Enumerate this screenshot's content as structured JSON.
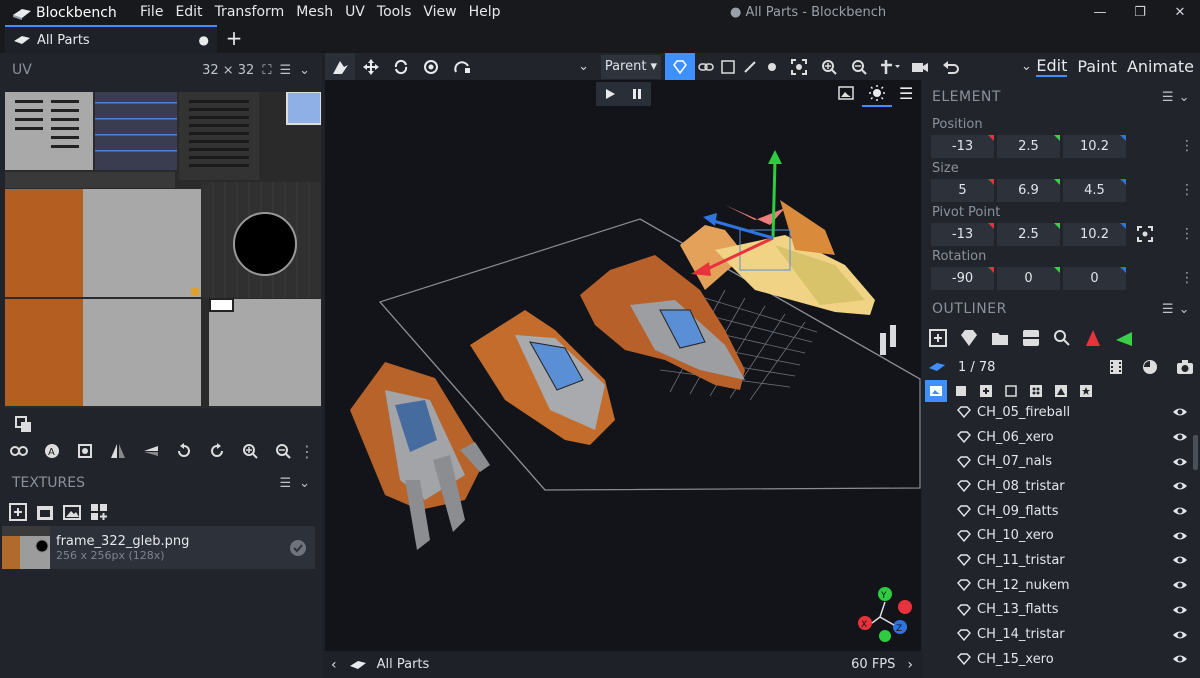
{
  "app": {
    "name": "Blockbench",
    "window_title": "● All Parts - Blockbench"
  },
  "menu": [
    "File",
    "Edit",
    "Transform",
    "Mesh",
    "UV",
    "Tools",
    "View",
    "Help"
  ],
  "window_controls": {
    "min": "—",
    "max": "❐",
    "close": "✕"
  },
  "tab": {
    "label": "All Parts",
    "modified": "●",
    "new": "+"
  },
  "uv_panel": {
    "title": "UV",
    "size": "32 ⨯ 32"
  },
  "textures_panel": {
    "title": "TEXTURES",
    "item": {
      "name": "frame_322_gleb.png",
      "resolution": "256 x 256px (128x)"
    }
  },
  "viewport": {
    "parent_select": "Parent ▾",
    "fps": "60 FPS",
    "footer_label": "All Parts"
  },
  "modes": [
    "Edit",
    "Paint",
    "Animate"
  ],
  "element_panel": {
    "title": "ELEMENT",
    "position": {
      "label": "Position",
      "values": [
        "-13",
        "2.5",
        "10.2"
      ]
    },
    "size": {
      "label": "Size",
      "values": [
        "5",
        "6.9",
        "4.5"
      ]
    },
    "pivot": {
      "label": "Pivot Point",
      "values": [
        "-13",
        "2.5",
        "10.2"
      ]
    },
    "rotation": {
      "label": "Rotation",
      "values": [
        "-90",
        "0",
        "0"
      ]
    }
  },
  "outliner": {
    "title": "OUTLINER",
    "count": "1 / 78",
    "items": [
      "CH_05_fireball",
      "CH_06_xero",
      "CH_07_nals",
      "CH_08_tristar",
      "CH_09_flatts",
      "CH_10_xero",
      "CH_11_tristar",
      "CH_12_nukem",
      "CH_13_flatts",
      "CH_14_tristar",
      "CH_15_xero"
    ]
  },
  "colors": {
    "accent": "#3e90ff",
    "x_axis": "#e8323c",
    "y_axis": "#3bd04a",
    "z_axis": "#2f74e0"
  }
}
